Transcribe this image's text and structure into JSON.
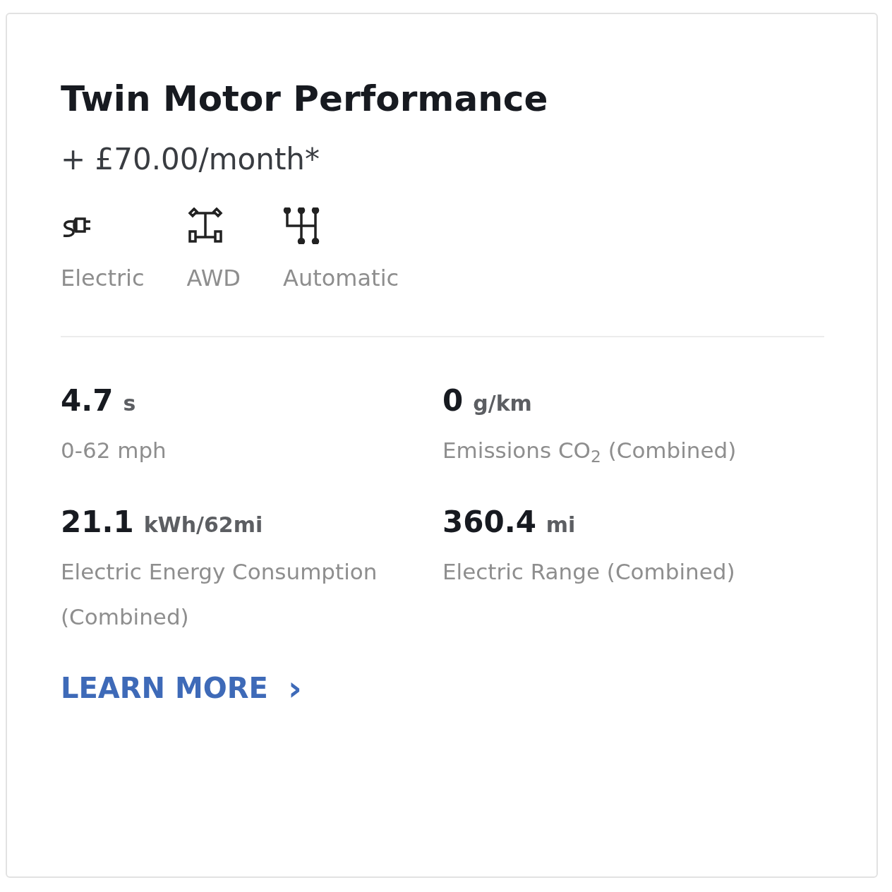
{
  "card": {
    "title": "Twin Motor Performance",
    "price": "+ £70.00/month*",
    "features": [
      {
        "label": "Electric"
      },
      {
        "label": "AWD"
      },
      {
        "label": "Automatic"
      }
    ],
    "stats": [
      {
        "value": "4.7",
        "unit": "s",
        "label": "0-62 mph"
      },
      {
        "value": "0",
        "unit": "g/km",
        "label": "Emissions CO$_{2}$ (Combined)"
      },
      {
        "value": "21.1",
        "unit": "kWh/62mi",
        "label": "Electric Energy Consumption (Combined)"
      },
      {
        "value": "360.4",
        "unit": "mi",
        "label": "Electric Range (Combined)"
      }
    ],
    "link": "LEARN MORE",
    "link_arrow": "›"
  }
}
